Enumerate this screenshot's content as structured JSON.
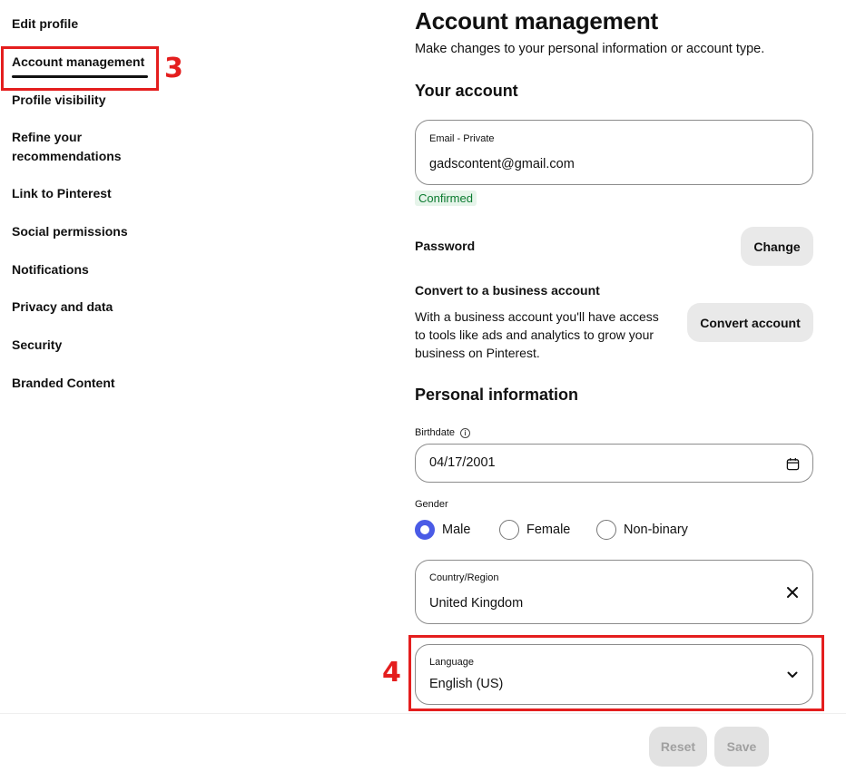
{
  "sidebar": {
    "items": [
      {
        "label": "Edit profile"
      },
      {
        "label": "Account management",
        "active": true
      },
      {
        "label": "Profile visibility"
      },
      {
        "label": "Refine your recommendations"
      },
      {
        "label": "Link to Pinterest"
      },
      {
        "label": "Social permissions"
      },
      {
        "label": "Notifications"
      },
      {
        "label": "Privacy and data"
      },
      {
        "label": "Security"
      },
      {
        "label": "Branded Content"
      }
    ]
  },
  "annotations": {
    "step_account": "3",
    "step_language": "4",
    "color": "#e41e1e"
  },
  "main": {
    "title": "Account management",
    "subtitle": "Make changes to your personal information or account type.",
    "your_account": {
      "heading": "Your account",
      "email_label": "Email - Private",
      "email_value": "gadscontent@gmail.com",
      "email_status": "Confirmed",
      "password_label": "Password",
      "password_button": "Change",
      "convert_heading": "Convert to a business account",
      "convert_description": "With a business account you'll have access to tools like ads and analytics to grow your business on Pinterest.",
      "convert_button": "Convert account"
    },
    "personal_info": {
      "heading": "Personal information",
      "birthdate_label": "Birthdate",
      "birthdate_value": "04/17/2001",
      "gender_label": "Gender",
      "gender_options": [
        {
          "label": "Male",
          "checked": true
        },
        {
          "label": "Female",
          "checked": false
        },
        {
          "label": "Non-binary",
          "checked": false
        }
      ],
      "country_label": "Country/Region",
      "country_value": "United Kingdom",
      "language_label": "Language",
      "language_value": "English (US)"
    }
  },
  "footer": {
    "reset_label": "Reset",
    "save_label": "Save"
  },
  "colors": {
    "accent_radio": "#4a5be6",
    "confirmed_bg": "#e6f4ea",
    "confirmed_text": "#0a7a2f",
    "button_bg": "#e9e9e9"
  }
}
